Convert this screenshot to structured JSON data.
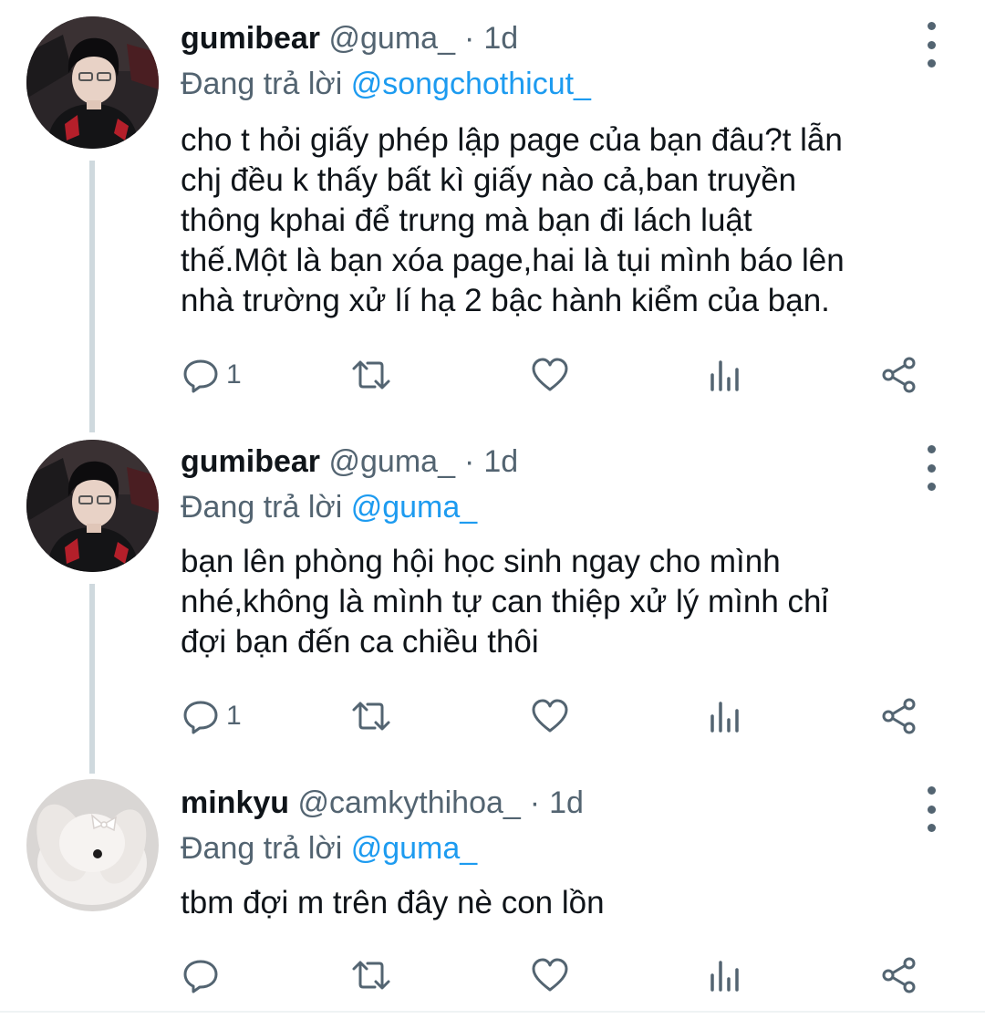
{
  "tweets": [
    {
      "name": "gumibear",
      "handle": "@guma_",
      "dot": "·",
      "time": "1d",
      "reply_prefix": "Đang trả lời",
      "reply_to": "@songchothicut_",
      "lines": [
        "cho t hỏi giấy phép lập page của bạn đâu?t lẫn",
        "chj đều k thấy bất kì giấy nào cả,ban truyền",
        "thông kphai để trưng mà bạn đi lách luật",
        "thế.Một là bạn xóa page,hai là tụi mình báo lên",
        "nhà trường xử lí hạ 2 bậc hành kiểm của bạn."
      ],
      "reply_count": "1",
      "avatar_icon": "avatar-person-icon"
    },
    {
      "name": "gumibear",
      "handle": "@guma_",
      "dot": "·",
      "time": "1d",
      "reply_prefix": "Đang trả lời",
      "reply_to": "@guma_",
      "lines": [
        "bạn lên phòng hội học sinh ngay cho mình",
        "nhé,không là mình tự can thiệp xử lý mình chỉ",
        "đợi bạn đến ca chiều thôi"
      ],
      "reply_count": "1",
      "avatar_icon": "avatar-person-icon"
    },
    {
      "name": "minkyu",
      "handle": "@camkythihoa_",
      "dot": "·",
      "time": "1d",
      "reply_prefix": "Đang trả lời",
      "reply_to": "@guma_",
      "lines": [
        "tbm đợi m trên đây nè con lồn"
      ],
      "reply_count": "",
      "avatar_icon": "avatar-bunny-icon"
    }
  ],
  "icons": {
    "reply": "reply-icon",
    "retweet": "retweet-icon",
    "like": "heart-icon",
    "stats": "analytics-icon",
    "share": "share-icon",
    "more": "more-vertical-icon"
  },
  "colors": {
    "name": "#0f1419",
    "secondary": "#536471",
    "mention": "#1d9bf0",
    "thread_line": "#cfd9de"
  }
}
